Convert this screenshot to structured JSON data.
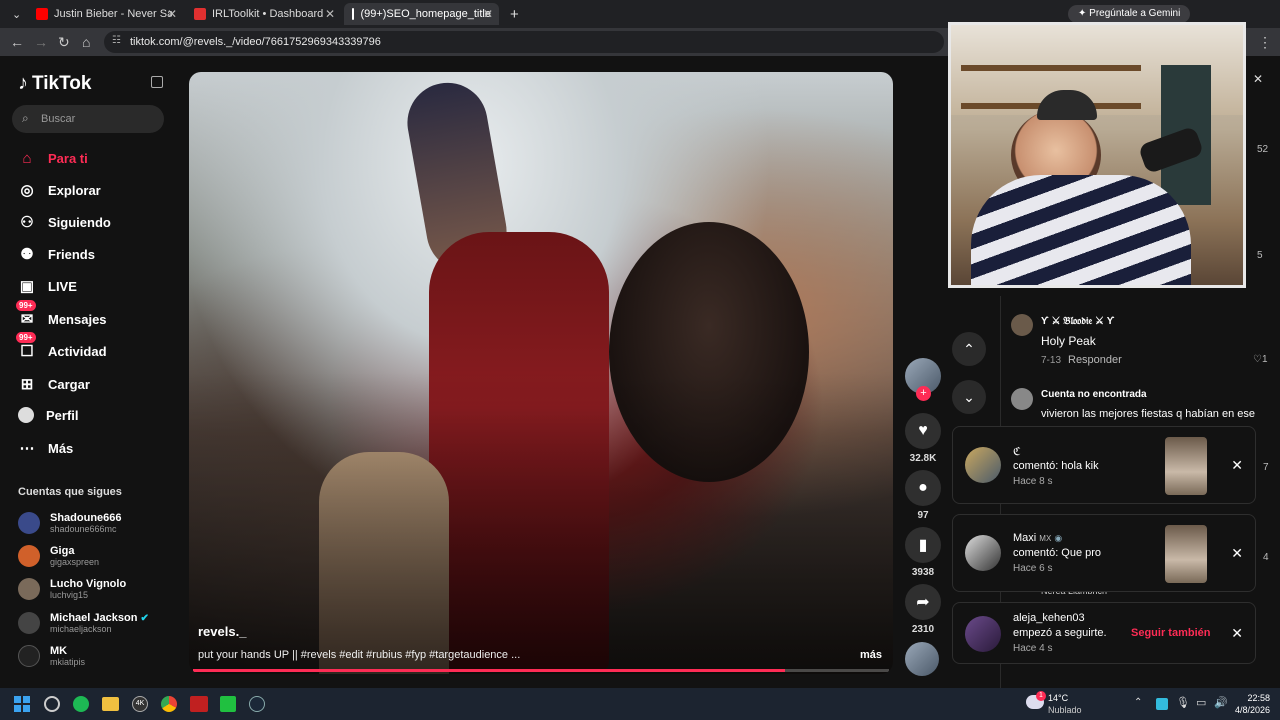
{
  "browser": {
    "tabs": [
      {
        "title": "Justin Bieber - Never Say Never",
        "color": "#ff0000"
      },
      {
        "title": "IRLToolkit • Dashboard",
        "color": "#e03030"
      },
      {
        "title": "(99+)SEO_homepage_title",
        "color": "#000000"
      }
    ],
    "url": "tiktok.com/@revels._/video/7661752969343339796",
    "gemini_label": "Pregúntale a Gemini"
  },
  "sidebar": {
    "logo": "TikTok",
    "search_placeholder": "Buscar",
    "nav": [
      {
        "label": "Para ti",
        "icon": "home-icon",
        "active": true
      },
      {
        "label": "Explorar",
        "icon": "compass-icon"
      },
      {
        "label": "Siguiendo",
        "icon": "user-follow-icon"
      },
      {
        "label": "Friends",
        "icon": "friends-icon"
      },
      {
        "label": "LIVE",
        "icon": "live-icon"
      },
      {
        "label": "Mensajes",
        "icon": "messages-icon",
        "badge": "99+"
      },
      {
        "label": "Actividad",
        "icon": "activity-icon",
        "badge": "99+"
      },
      {
        "label": "Cargar",
        "icon": "upload-icon"
      },
      {
        "label": "Perfil",
        "icon": "profile-icon"
      },
      {
        "label": "Más",
        "icon": "more-icon"
      }
    ],
    "following_heading": "Cuentas que sigues",
    "following": [
      {
        "name": "Shadoune666",
        "user": "shadoune666mc",
        "color": "#3a4a8a"
      },
      {
        "name": "Giga",
        "user": "gigaxspreen",
        "color": "#d0602a"
      },
      {
        "name": "Lucho Vignolo",
        "user": "luchvig15",
        "color": "#7a6a5a"
      },
      {
        "name": "Michael Jackson",
        "user": "michaeljackson",
        "color": "#444444",
        "verified": true
      },
      {
        "name": "MK",
        "user": "mkiatipis",
        "color": "#222222"
      }
    ]
  },
  "video": {
    "author": "revels._",
    "caption": "put your hands UP || #revels #edit #rubius #fyp #targetaudience ...",
    "more": "más",
    "progress": 0.85
  },
  "actions": {
    "likes": "32.8K",
    "comments": "97",
    "saves": "3938",
    "shares": "2310"
  },
  "comments": [
    {
      "user": "ϒ ⚔ 𝔅𝔩𝔬𝔬𝔡𝔦𝔢 ⚔ ϒ",
      "text": "Holy Peak",
      "date": "7-13",
      "reply": "Responder",
      "likes": "1"
    },
    {
      "user": "Cuenta no encontrada",
      "text": "vivieron las mejores fiestas q habían en ese"
    }
  ],
  "comment_side_counts": [
    "52",
    "5",
    "7",
    "4"
  ],
  "partial_names": [
    "Nerea Llambrich"
  ],
  "notifications": [
    {
      "name": "ℭ",
      "line": "comentó: hola kik",
      "time": "Hace 8 s"
    },
    {
      "name": "Maxi",
      "tag": "MX",
      "line": "comentó: Que pro",
      "time": "Hace 6 s"
    },
    {
      "name": "aleja_kehen03",
      "line": "empezó a seguirte.",
      "time": "Hace 4 s",
      "action": "Seguir también"
    }
  ],
  "taskbar": {
    "weather_temp": "14°C",
    "weather_desc": "Nublado",
    "weather_badge": "1",
    "time": "22:58",
    "date": "4/8/2026"
  }
}
